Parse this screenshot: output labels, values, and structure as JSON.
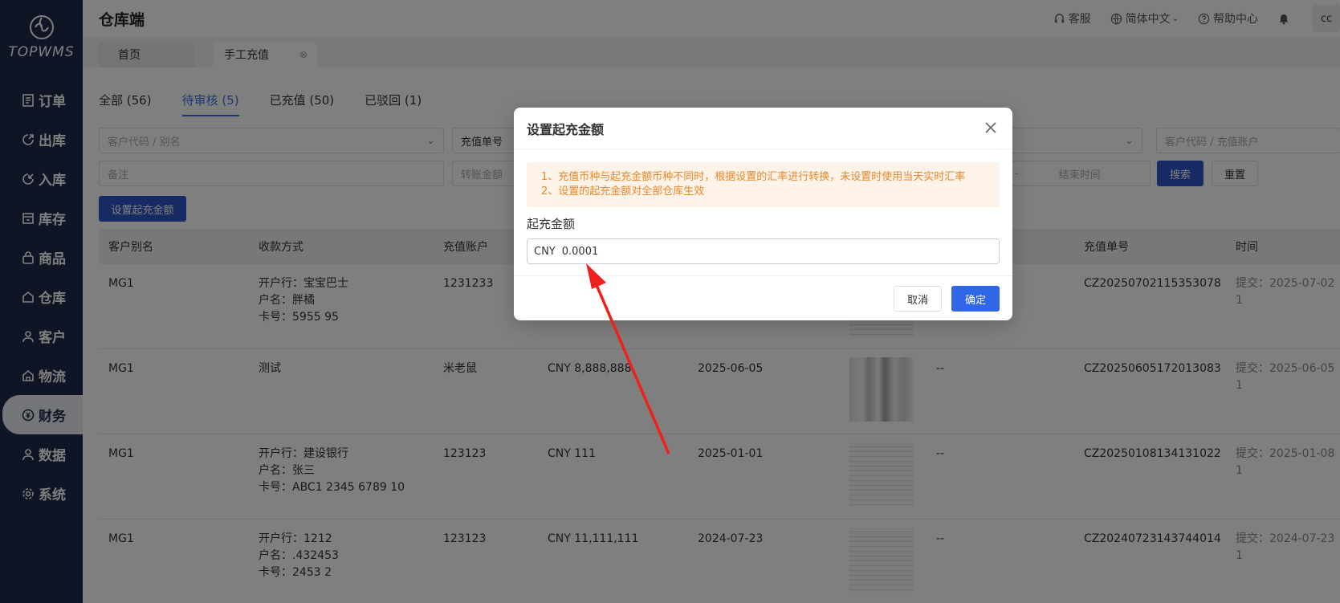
{
  "app": {
    "logo_text": "TOPWMS",
    "page_title": "仓库端"
  },
  "sidebar": {
    "items": [
      {
        "label": "订单",
        "icon": "order-icon"
      },
      {
        "label": "出库",
        "icon": "outbound-icon"
      },
      {
        "label": "入库",
        "icon": "inbound-icon"
      },
      {
        "label": "库存",
        "icon": "inventory-icon"
      },
      {
        "label": "商品",
        "icon": "product-icon"
      },
      {
        "label": "仓库",
        "icon": "warehouse-icon"
      },
      {
        "label": "客户",
        "icon": "customer-icon"
      },
      {
        "label": "物流",
        "icon": "logistics-icon"
      },
      {
        "label": "财务",
        "icon": "finance-icon",
        "active": true
      },
      {
        "label": "数据",
        "icon": "data-icon"
      },
      {
        "label": "系统",
        "icon": "system-icon"
      }
    ]
  },
  "header": {
    "service": "客服",
    "language": "简体中文",
    "help": "帮助中心",
    "avatar": "cc"
  },
  "page_tabs": {
    "home": "首页",
    "current": "手工充值"
  },
  "status_tabs": [
    {
      "label": "全部 (56)"
    },
    {
      "label": "待审核 (5)",
      "active": true
    },
    {
      "label": "已充值 (50)"
    },
    {
      "label": "已驳回 (1)"
    }
  ],
  "filters": {
    "customer_placeholder": "客户代码 / 别名",
    "recharge_no_select": "充值单号",
    "customer_account_placeholder": "客户代码 / 充值账户",
    "remark_placeholder": "备注",
    "transfer_amount_placeholder": "转账金额",
    "range_sep": "-",
    "end_time_placeholder": "结束时间",
    "search_btn": "搜索",
    "reset_btn": "重置",
    "set_min_btn": "设置起充金额"
  },
  "table": {
    "headers": [
      "客户别名",
      "收款方式",
      "充值账户",
      "充值单号",
      "时间"
    ],
    "rows": [
      {
        "alias": "MG1",
        "pay": [
          "开户行：宝宝巴士",
          "户名：胖橘",
          "卡号：5955 95"
        ],
        "account": "1231233",
        "amount": "",
        "date": "",
        "remark": "",
        "order_no": "CZ20250702115353078",
        "time": "提交：2025-07-02 1"
      },
      {
        "alias": "MG1",
        "pay": [
          "测试"
        ],
        "account": "米老鼠",
        "amount": "CNY 8,888,888",
        "date": "2025-06-05",
        "remark": "--",
        "order_no": "CZ20250605172013083",
        "time": "提交：2025-06-05 1"
      },
      {
        "alias": "MG1",
        "pay": [
          "开户行：建设银行",
          "户名：张三",
          "卡号：ABC1 2345 6789 10"
        ],
        "account": "123123",
        "amount": "CNY 111",
        "date": "2025-01-01",
        "remark": "--",
        "order_no": "CZ20250108134131022",
        "time": "提交：2025-01-08 1"
      },
      {
        "alias": "MG1",
        "pay": [
          "开户行：1212",
          "户名：.432453",
          "卡号：2453 2"
        ],
        "account": "123123",
        "amount": "CNY 11,111,111",
        "date": "2024-07-23",
        "remark": "--",
        "order_no": "CZ20240723143744014",
        "time": "提交：2024-07-23 1"
      }
    ]
  },
  "modal": {
    "title": "设置起充金额",
    "notice": [
      "1、充值币种与起充金额币种不同时，根据设置的汇率进行转换，未设置时使用当天实时汇率",
      "2、设置的起充金额对全部仓库生效"
    ],
    "field_label": "起充金额",
    "currency": "CNY",
    "value": "0.0001",
    "cancel": "取消",
    "confirm": "确定"
  },
  "colors": {
    "sidebar": "#1f2a48",
    "primary": "#3066e8",
    "notice_bg": "#fdf3e8",
    "notice_text": "#e8872a",
    "annotation_arrow": "#f0201c"
  }
}
